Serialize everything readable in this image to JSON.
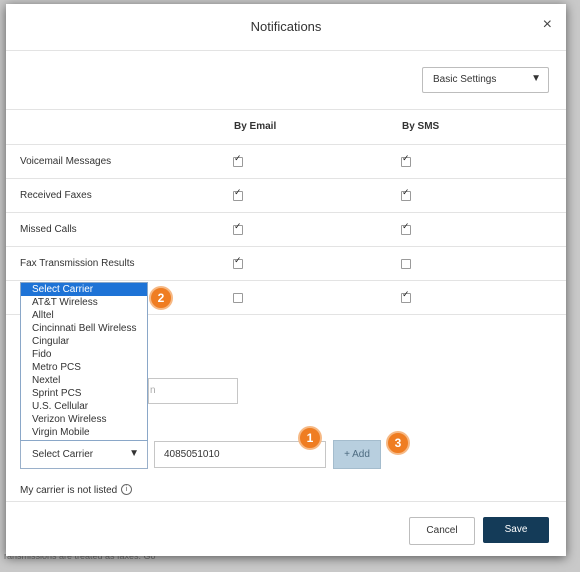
{
  "modal": {
    "title": "Notifications",
    "close_symbol": "×"
  },
  "settings": {
    "selected": "Basic Settings",
    "arrow": "▼"
  },
  "columns": {
    "email": "By Email",
    "sms": "By SMS"
  },
  "rows": [
    {
      "label": "Voicemail Messages",
      "email": true,
      "sms": true
    },
    {
      "label": "Received Faxes",
      "email": true,
      "sms": true
    },
    {
      "label": "Missed Calls",
      "email": true,
      "sms": true
    },
    {
      "label": "Fax Transmission Results",
      "email": true,
      "sms": false
    },
    {
      "label": "",
      "email": false,
      "sms": true
    }
  ],
  "carrier_options": [
    "Select Carrier",
    "AT&T Wireless",
    "Alltel",
    "Cincinnati Bell Wireless",
    "Cingular",
    "Fido",
    "Metro PCS",
    "Nextel",
    "Sprint PCS",
    "U.S. Cellular",
    "Verizon Wireless",
    "Virgin Mobile"
  ],
  "email_input": {
    "value_fragment": "n"
  },
  "carrier_select": {
    "selected": "Select Carrier",
    "arrow": "▼"
  },
  "phone_input": {
    "value": "4085051010"
  },
  "add_button": {
    "label": "+ Add"
  },
  "not_listed": {
    "text": "My carrier is not listed",
    "icon": "info-icon",
    "icon_glyph": "i"
  },
  "badges": {
    "one": "1",
    "two": "2",
    "three": "3"
  },
  "footer": {
    "cancel": "Cancel",
    "save": "Save"
  },
  "backdrop_text": "ransmissions are treated as faxes. Go"
}
